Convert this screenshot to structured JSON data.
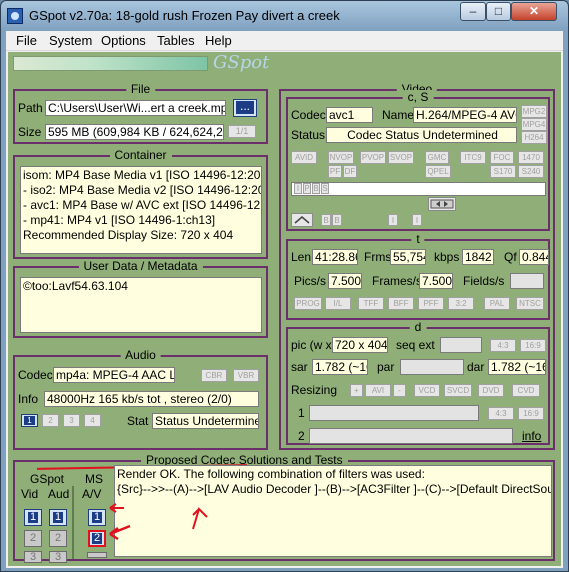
{
  "window": {
    "title": "GSpot v2.70a: 18-gold rush Frozen Pay divert a creek",
    "app_icon": "gspot-app-icon"
  },
  "caption_buttons": {
    "minimize": "–",
    "maximize": "□",
    "close": "✕"
  },
  "menu": [
    "File",
    "System",
    "Options",
    "Tables",
    "Help"
  ],
  "logo": "GSpot",
  "file": {
    "title": "File",
    "path_label": "Path",
    "path": "C:\\Users\\User\\Wi...ert a creek.mp4",
    "browse": "...",
    "size_label": "Size",
    "size": "595 MB (609,984 KB / 624,624,289",
    "part": "1/1"
  },
  "container": {
    "title": "Container",
    "lines": [
      "isom: MP4  Base Media v1 [ISO 14496-12:2003]",
      "- iso2: MP4 Base Media v2 [ISO 14496-12:2005]",
      "- avc1: MP4 Base w/ AVC ext [ISO 14496-12:200",
      "- mp41: MP4 v1 [ISO 14496-1:ch13]",
      "Recommended Display Size: 720 x 404"
    ]
  },
  "userdata": {
    "title": "User Data / Metadata",
    "text": "©too:Lavf54.63.104"
  },
  "audio": {
    "title": "Audio",
    "codec_label": "Codec",
    "codec": "mp4a: MPEG-4 AAC LC",
    "cbr": "CBR",
    "vbr": "VBR",
    "info_label": "Info",
    "info": "48000Hz  165 kb/s tot , stereo (2/0)",
    "stream_buttons": [
      "1",
      "2",
      "3",
      "4"
    ],
    "stat_label": "Stat",
    "stat": "Status Undetermined"
  },
  "video": {
    "title": "Video",
    "cs_title": "c, S",
    "codec_label": "Codec",
    "codec": "avc1",
    "name_label": "Name",
    "name": "H.264/MPEG-4 AVC",
    "side_tags": [
      "MPG2",
      "MPG4",
      "H264"
    ],
    "status_label": "Status",
    "status": "Codec Status Undetermined",
    "flags_row1": [
      "AVID",
      "NVOP",
      "PVOP",
      "SVOP",
      "GMC",
      "ITC9",
      "FOC",
      "1470"
    ],
    "flags_row2": [
      "PF",
      "DF",
      "QPEL",
      "S170",
      "S240"
    ],
    "frame_tags": [
      "I",
      "P",
      "B",
      "S"
    ],
    "timeline_icon": "timeline-link-icon",
    "timeline_labels": [
      "B",
      "B",
      "I",
      "I"
    ],
    "t_title": "t",
    "len_label": "Len",
    "len": "41:28.868",
    "frms_label": "Frms",
    "frms": "55,754",
    "kbps_label": "kbps",
    "kbps": "1842",
    "qf_label": "Qf",
    "qf": "0.844",
    "pics_label": "Pics/s",
    "pics": "7.500",
    "frames_label": "Frames/s",
    "frames": "7.500",
    "fields_label": "Fields/s",
    "fields": "",
    "flags_row3": [
      "PROG",
      "I/L",
      "TFF",
      "BFF",
      "PFF",
      "3:2",
      "PAL",
      "NTSC"
    ],
    "d_title": "d",
    "pic_label": "pic (w x",
    "pic": "720 x 404",
    "seqext_label": "seq ext",
    "seqext": "",
    "ar_tags": [
      "4:3",
      "16:9"
    ],
    "sar_label": "sar",
    "sar": "1.782 (~16:",
    "par_label": "par",
    "par": "",
    "dar_label": "dar",
    "dar": "1.782 (~16:",
    "resizing_label": "Resizing",
    "resize_buttons": [
      "+",
      "AVI",
      "-",
      "VCD",
      "SVCD",
      "DVD",
      "CVD"
    ],
    "row1_label": "1",
    "row2_label": "2",
    "row1_tags": [
      "4:3",
      "16:9"
    ],
    "info_link": "info"
  },
  "proposed": {
    "title": "Proposed Codec Solutions and Tests",
    "gspot_label": "GSpot",
    "vid_label": "Vid",
    "aud_label": "Aud",
    "ms_label": "MS",
    "av_label": "A/V",
    "vid_buttons": [
      "1",
      "2",
      "3"
    ],
    "aud_buttons": [
      "1",
      "2",
      "3"
    ],
    "ms_buttons": [
      "1",
      "2"
    ],
    "render_lines": [
      "Render OK. The following combination of filters was used:",
      "{Src}-->>--(A)-->[LAV Audio Decoder ]--(B)-->[AC3Filter ]--(C)-->[Default DirectSound Device"
    ]
  }
}
